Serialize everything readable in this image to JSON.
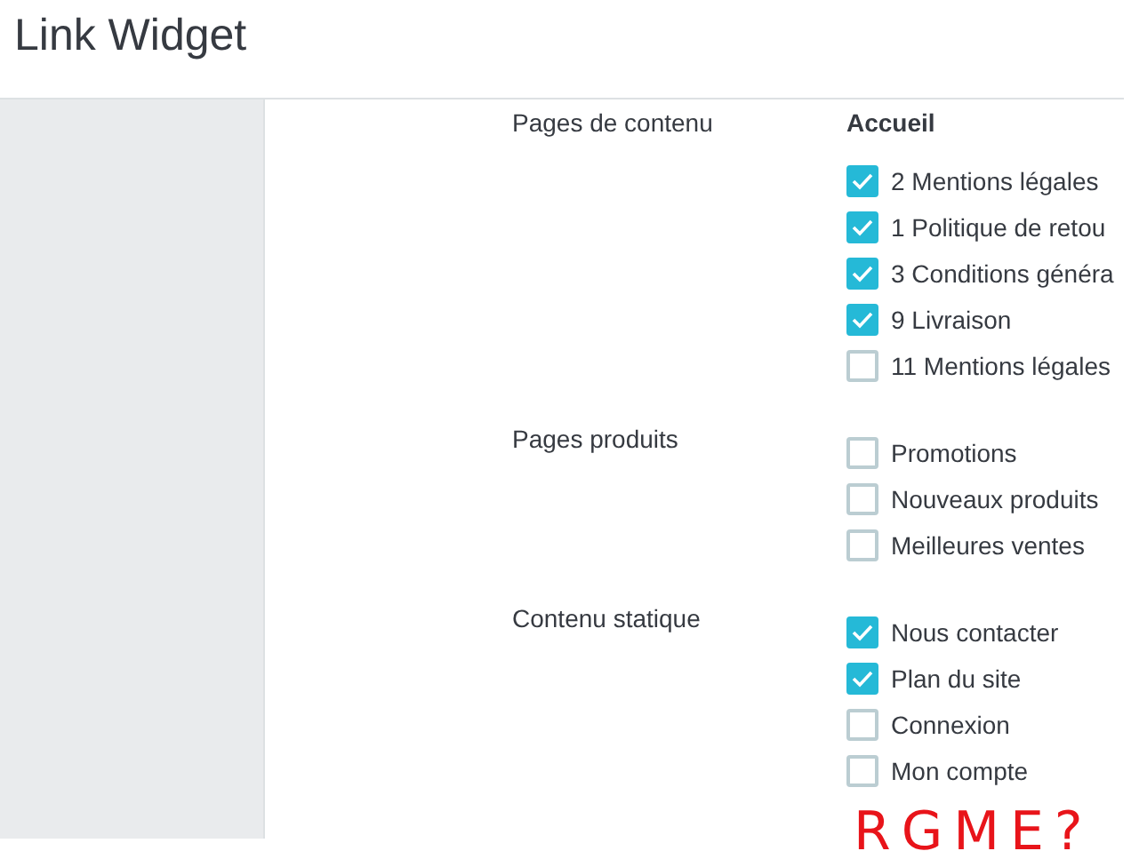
{
  "page_title": "Link Widget",
  "sections": [
    {
      "label": "Pages de contenu",
      "heading": "Accueil",
      "options": [
        {
          "label": "2 Mentions légales",
          "checked": true
        },
        {
          "label": "1 Politique de retou",
          "checked": true
        },
        {
          "label": "3 Conditions généra",
          "checked": true
        },
        {
          "label": "9 Livraison",
          "checked": true
        },
        {
          "label": "11 Mentions légales",
          "checked": false
        }
      ]
    },
    {
      "label": "Pages produits",
      "options": [
        {
          "label": "Promotions",
          "checked": false
        },
        {
          "label": "Nouveaux produits",
          "checked": false
        },
        {
          "label": "Meilleures ventes",
          "checked": false
        }
      ]
    },
    {
      "label": "Contenu statique",
      "options": [
        {
          "label": "Nous contacter",
          "checked": true
        },
        {
          "label": "Plan du site",
          "checked": true
        },
        {
          "label": "Connexion",
          "checked": false
        },
        {
          "label": "Mon compte",
          "checked": false
        }
      ]
    }
  ],
  "annotation": "RGME?"
}
